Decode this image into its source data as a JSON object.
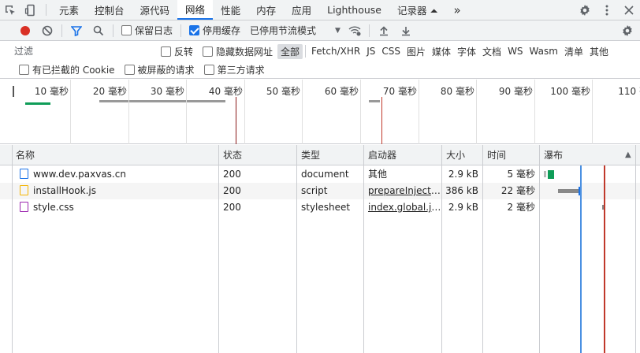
{
  "tabs": {
    "items": [
      "元素",
      "控制台",
      "源代码",
      "网络",
      "性能",
      "内存",
      "应用",
      "Lighthouse",
      "记录器 ⏶"
    ],
    "active_index": 3,
    "more": "»"
  },
  "toolbar": {
    "preserve_log": "保留日志",
    "disable_cache": "停用缓存",
    "throttle_value": "已停用节流模式",
    "throttle_arrow": "▼"
  },
  "filter": {
    "placeholder": "过滤",
    "invert": "反转",
    "hide_data_urls": "隐藏数据网址",
    "types": [
      "全部",
      "Fetch/XHR",
      "JS",
      "CSS",
      "图片",
      "媒体",
      "字体",
      "文档",
      "WS",
      "Wasm",
      "清单",
      "其他"
    ],
    "active_type": 0,
    "blocked_cookies": "有已拦截的 Cookie",
    "blocked_requests": "被屏蔽的请求",
    "third_party": "第三方请求"
  },
  "overview": {
    "ticks": [
      "10 毫秒",
      "20 毫秒",
      "30 毫秒",
      "40 毫秒",
      "50 毫秒",
      "60 毫秒",
      "70 毫秒",
      "80 毫秒",
      "90 毫秒",
      "100 毫秒",
      "110 毫"
    ]
  },
  "table": {
    "headers": {
      "name": "名称",
      "status": "状态",
      "type": "类型",
      "initiator": "启动器",
      "size": "大小",
      "time": "时间",
      "waterfall": "瀑布",
      "sort_arrow": "▲"
    },
    "rows": [
      {
        "name": "www.dev.paxvas.cn",
        "icon": "document-icon",
        "status": "200",
        "type": "document",
        "initiator": "其他",
        "initiator_link": false,
        "size": "2.9 kB",
        "time": "5 毫秒"
      },
      {
        "name": "installHook.js",
        "icon": "script-icon",
        "status": "200",
        "type": "script",
        "initiator": "prepareInjectio...",
        "initiator_link": true,
        "size": "386 kB",
        "time": "22 毫秒"
      },
      {
        "name": "style.css",
        "icon": "stylesheet-icon",
        "status": "200",
        "type": "stylesheet",
        "initiator": "index.global.js:1",
        "initiator_link": true,
        "size": "2.9 kB",
        "time": "2 毫秒"
      }
    ]
  },
  "colors": {
    "accent": "#1a73e8",
    "record": "#d93025",
    "dom_content_loaded": "#4a90e2",
    "load": "#c0392b",
    "waiting_green": "#0f9d58",
    "bar_grey": "#888888"
  }
}
